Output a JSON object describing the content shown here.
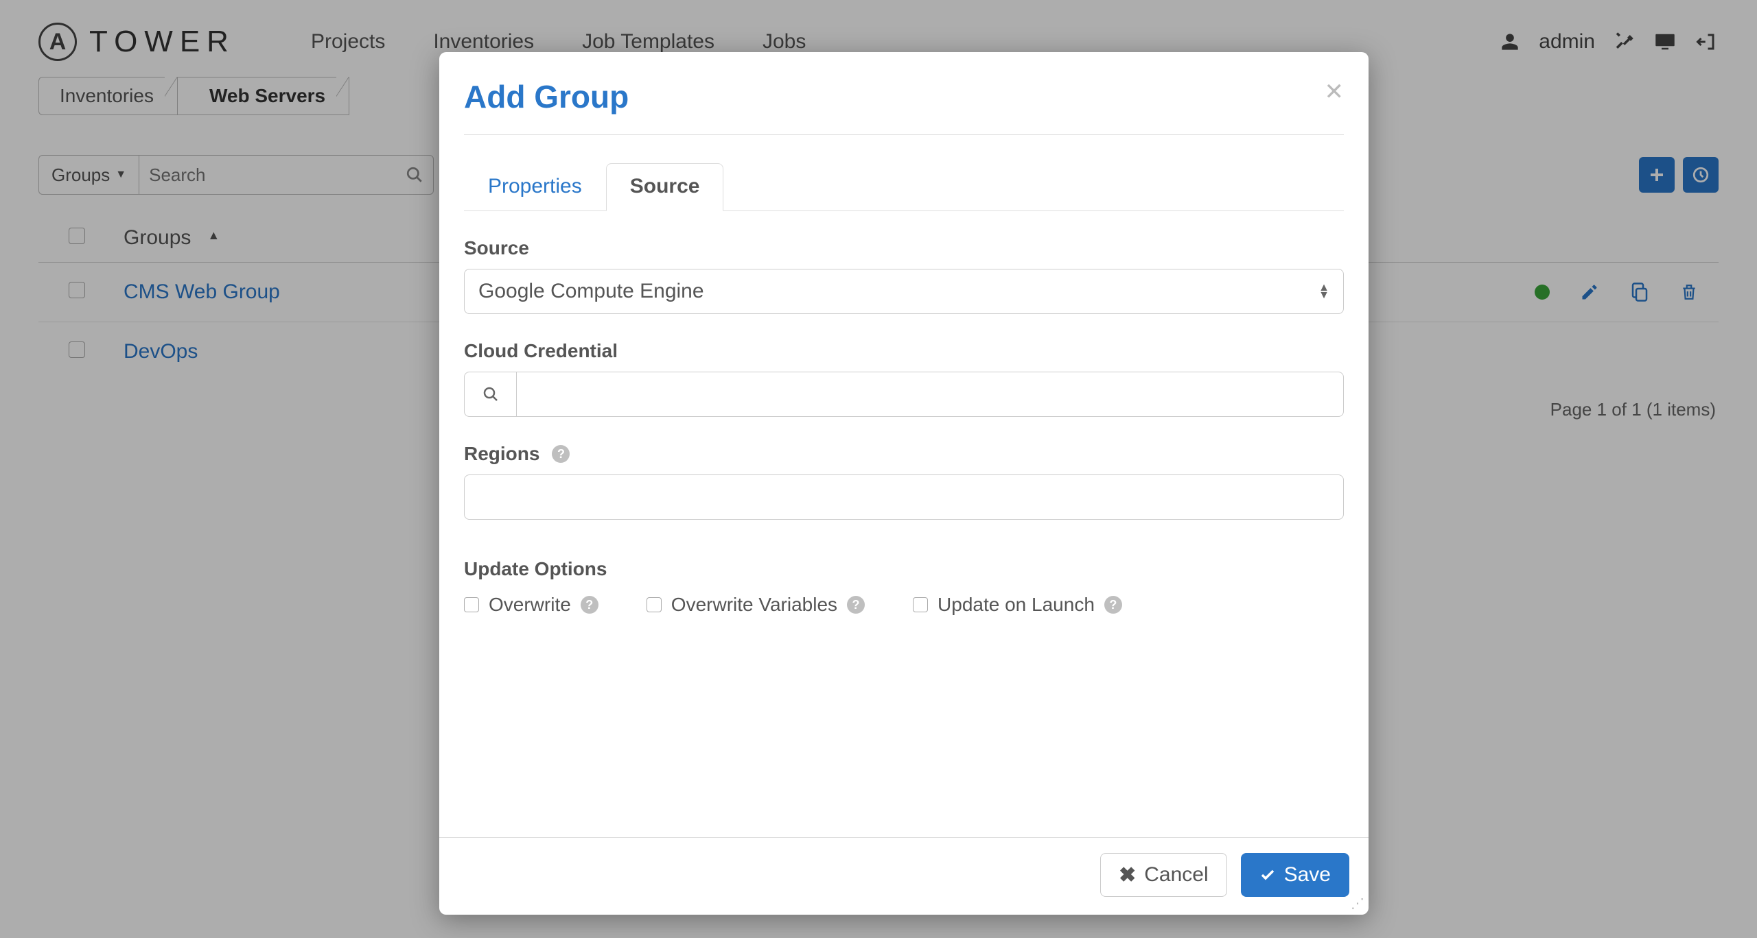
{
  "brand": {
    "glyph": "A",
    "name": "TOWER"
  },
  "nav": {
    "projects": "Projects",
    "inventories": "Inventories",
    "job_templates": "Job Templates",
    "jobs": "Jobs"
  },
  "user": {
    "name": "admin"
  },
  "breadcrumb": {
    "inventories": "Inventories",
    "current": "Web Servers"
  },
  "toolbar": {
    "dropdown_label": "Groups",
    "search_placeholder": "Search"
  },
  "table": {
    "header": "Groups",
    "rows": [
      {
        "name": "CMS Web Group",
        "status": "green"
      },
      {
        "name": "DevOps"
      }
    ]
  },
  "pagination": "Page 1 of 1 (1 items)",
  "modal": {
    "title": "Add Group",
    "tabs": {
      "properties": "Properties",
      "source": "Source"
    },
    "labels": {
      "source": "Source",
      "cloud_credential": "Cloud Credential",
      "regions": "Regions",
      "update_options": "Update Options"
    },
    "source_value": "Google Compute Engine",
    "cloud_credential_value": "",
    "regions_value": "",
    "options": {
      "overwrite": "Overwrite",
      "overwrite_vars": "Overwrite Variables",
      "update_on_launch": "Update on Launch"
    },
    "buttons": {
      "cancel": "Cancel",
      "save": "Save"
    }
  }
}
